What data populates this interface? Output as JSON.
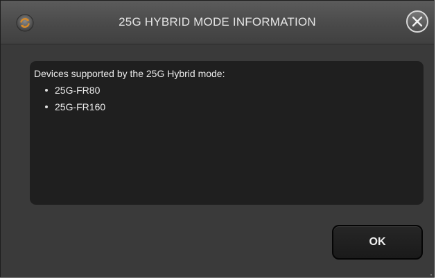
{
  "dialog": {
    "title": "25G HYBRID MODE INFORMATION",
    "app_icon": "refresh-icon",
    "close_icon": "close-circle-icon"
  },
  "info": {
    "intro": "Devices supported by the 25G Hybrid mode:",
    "devices": [
      "25G-FR80",
      "25G-FR160"
    ]
  },
  "buttons": {
    "ok_label": "OK"
  },
  "colors": {
    "dialog_bg": "#3a3a3a",
    "titlebar_bg": "#4a4a4a",
    "panel_bg": "#1f1f1f",
    "button_bg": "#1f1f1f",
    "text": "#e6e6e6"
  }
}
